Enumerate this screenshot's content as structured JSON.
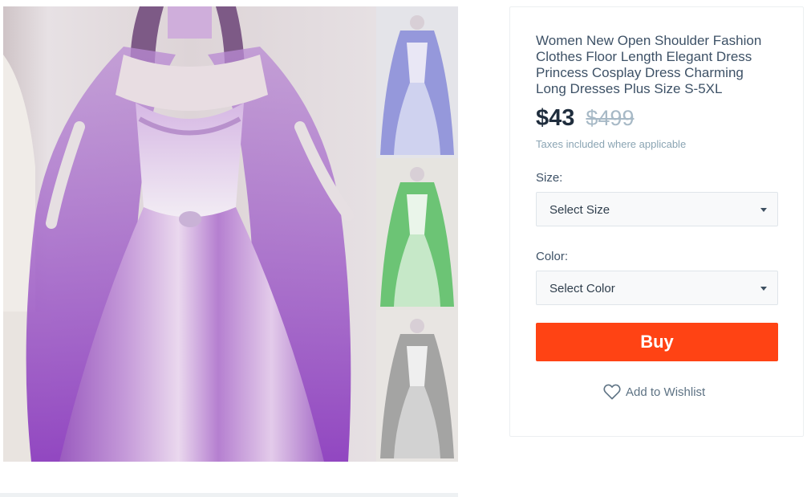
{
  "gallery": {
    "main_image": "purple-lilac-gown-main-photo",
    "thumbnails": [
      {
        "name": "thumb-blue",
        "color": "#7b7fd6"
      },
      {
        "name": "thumb-green",
        "color": "#4dbb5a"
      },
      {
        "name": "thumb-grey",
        "color": "#8d8d8d"
      }
    ]
  },
  "product": {
    "title": "Women New Open Shoulder Fashion Clothes Floor Length Elegant Dress Princess Cosplay Dress Charming Long Dresses Plus Size S-5XL",
    "price_current": "$43",
    "price_original": "$499",
    "tax_note": "Taxes included where applicable"
  },
  "options": {
    "size_label": "Size:",
    "size_value": "Select Size",
    "color_label": "Color:",
    "color_value": "Select Color"
  },
  "actions": {
    "buy_label": "Buy",
    "wishlist_label": "Add to Wishlist",
    "wishlist_icon": "heart-icon"
  },
  "colors": {
    "buy_accent": "#ff4314",
    "price_strike": "#a7b9c6",
    "dress_purple": "#a46bc4"
  }
}
